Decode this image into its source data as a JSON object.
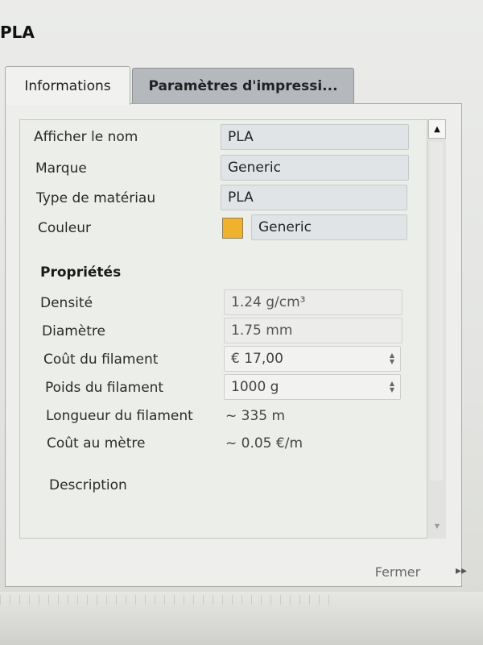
{
  "window": {
    "title": "PLA"
  },
  "tabs": [
    {
      "label": "Informations",
      "active": true
    },
    {
      "label": "Paramètres d'impressi...",
      "active": false
    }
  ],
  "fields": {
    "display_name": {
      "label": "Afficher le nom",
      "value": "PLA"
    },
    "brand": {
      "label": "Marque",
      "value": "Generic"
    },
    "material_type": {
      "label": "Type de matériau",
      "value": "PLA"
    },
    "color": {
      "label": "Couleur",
      "value": "Generic",
      "swatch": "#f0b22c"
    }
  },
  "properties": {
    "title": "Propriétés",
    "density": {
      "label": "Densité",
      "value": "1.24 g/cm³"
    },
    "diameter": {
      "label": "Diamètre",
      "value": "1.75 mm"
    },
    "filament_cost": {
      "label": "Coût du filament",
      "value": "€ 17,00"
    },
    "filament_weight": {
      "label": "Poids du filament",
      "value": "1000 g"
    },
    "filament_length": {
      "label": "Longueur du filament",
      "value": "~ 335 m"
    },
    "cost_per_meter": {
      "label": "Coût au mètre",
      "value": "~ 0.05 €/m"
    }
  },
  "description": {
    "label": "Description"
  },
  "buttons": {
    "close": "Fermer"
  },
  "icons": {
    "scroll_up": "scroll-up-arrow-icon",
    "scroll_down": "scroll-down-arrow-icon",
    "spinner": "spin-updown-icon"
  }
}
